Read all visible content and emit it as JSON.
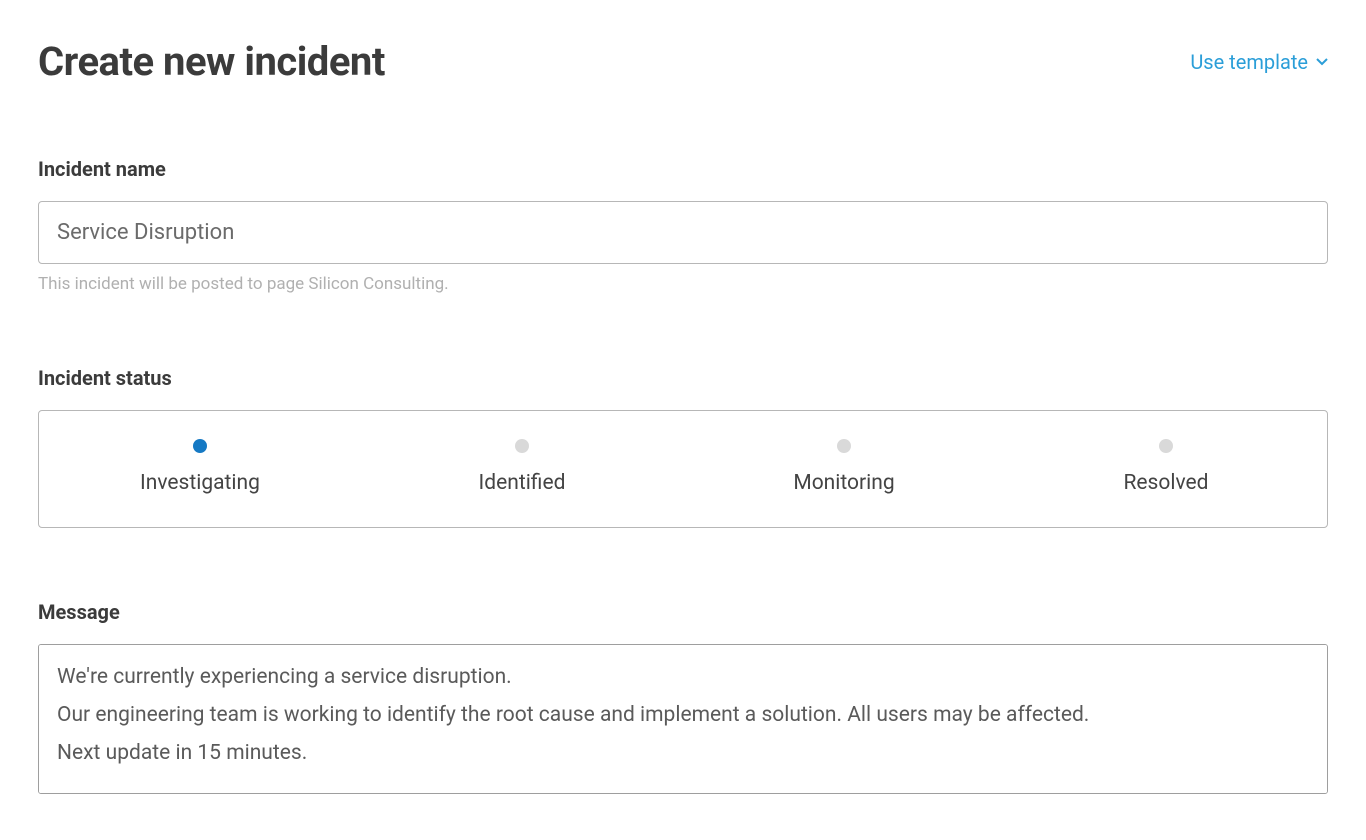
{
  "header": {
    "title": "Create new incident",
    "template_link": "Use template"
  },
  "incident_name": {
    "label": "Incident name",
    "value": "Service Disruption",
    "helper": "This incident will be posted to page Silicon Consulting."
  },
  "incident_status": {
    "label": "Incident status",
    "options": [
      {
        "label": "Investigating",
        "active": true
      },
      {
        "label": "Identified",
        "active": false
      },
      {
        "label": "Monitoring",
        "active": false
      },
      {
        "label": "Resolved",
        "active": false
      }
    ]
  },
  "message": {
    "label": "Message",
    "value": "We're currently experiencing a service disruption.\nOur engineering team is working to identify the root cause and implement a solution. All users may be affected.\nNext update in 15 minutes."
  }
}
